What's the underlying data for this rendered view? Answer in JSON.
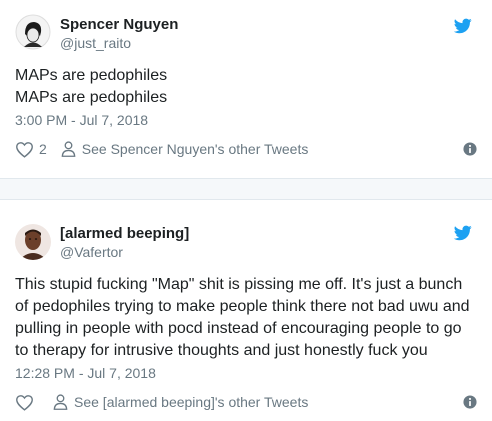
{
  "colors": {
    "text": "#1c2022",
    "muted": "#697882",
    "twitter_blue": "#1da1f2",
    "divider": "#e1e8ed",
    "gap_background": "#f5f8fa"
  },
  "tweets": [
    {
      "display_name": "Spencer Nguyen",
      "handle": "@just_raito",
      "text_lines": [
        "MAPs are pedophiles",
        "MAPs are pedophiles"
      ],
      "timestamp": "3:00 PM - Jul 7, 2018",
      "like_count": "2",
      "other_tweets_label": "See Spencer Nguyen's other Tweets",
      "icons": [
        "heart-icon",
        "person-icon",
        "info-icon",
        "twitter-bird-icon"
      ]
    },
    {
      "display_name": "[alarmed beeping]",
      "handle": "@Vafertor",
      "text_lines": [
        "This stupid fucking \"Map\" shit is pissing me off. It's just a bunch",
        "of pedophiles trying to make people think there not bad uwu and",
        "pulling in people with pocd instead of encouraging people to go",
        "to therapy for intrusive thoughts and just honestly fuck you"
      ],
      "timestamp": "12:28 PM - Jul 7, 2018",
      "like_count": "",
      "other_tweets_label": "See [alarmed beeping]'s other Tweets",
      "icons": [
        "heart-icon",
        "person-icon",
        "info-icon",
        "twitter-bird-icon"
      ]
    }
  ]
}
